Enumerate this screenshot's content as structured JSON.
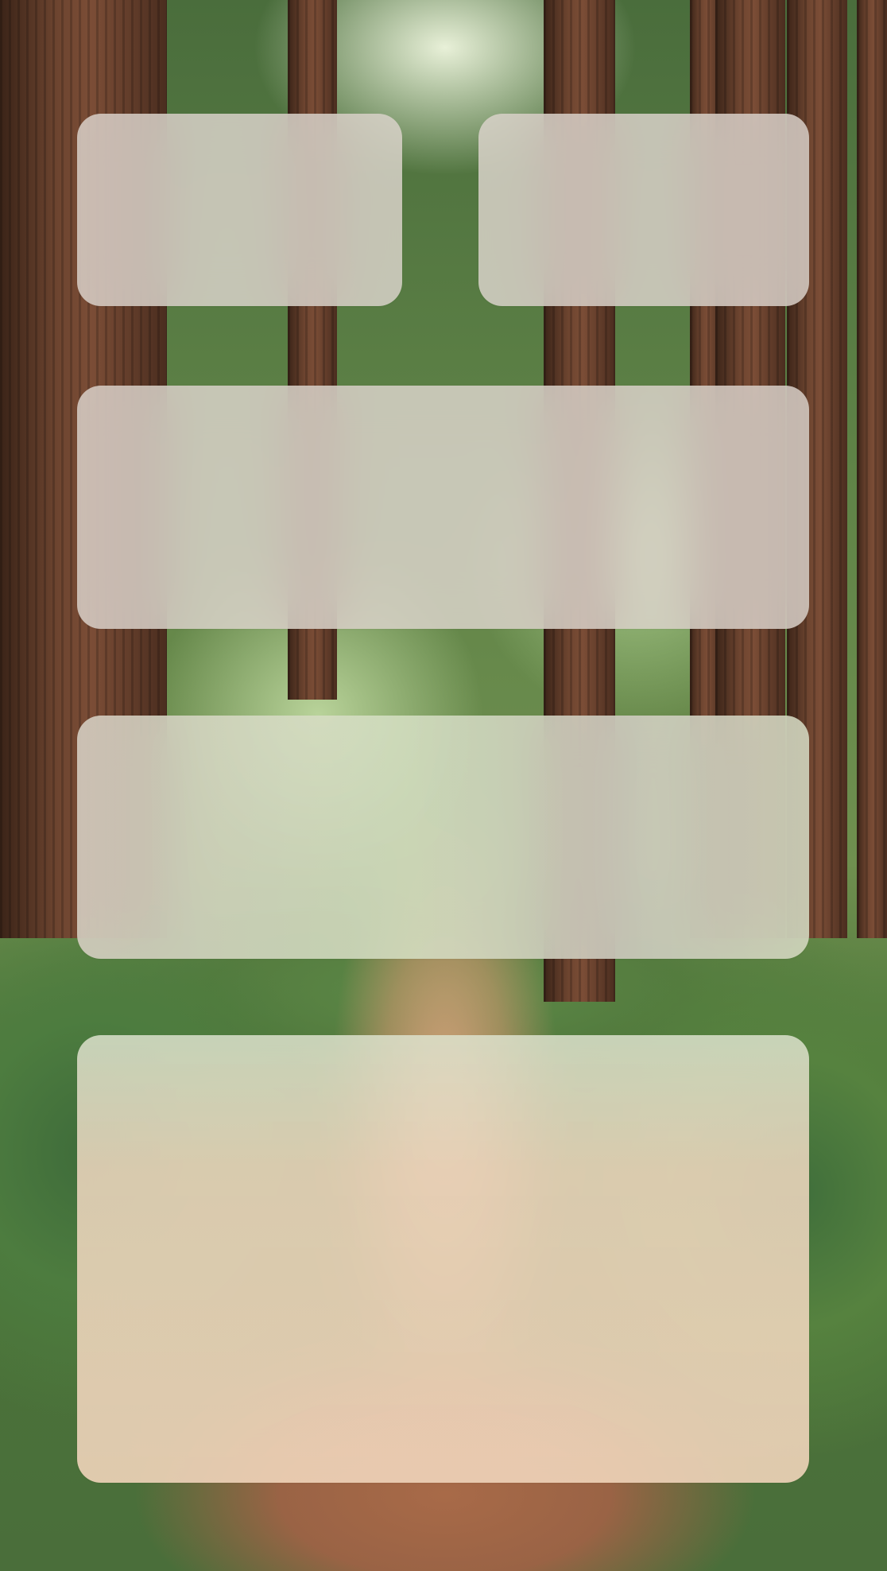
{
  "screen": {
    "wallpaper": "redwood-forest-path",
    "widget_tint": "#ded6ce"
  },
  "widgets": [
    {
      "id": "widget-small-left",
      "size": "small",
      "content": ""
    },
    {
      "id": "widget-small-right",
      "size": "small",
      "content": ""
    },
    {
      "id": "widget-medium-1",
      "size": "medium",
      "content": ""
    },
    {
      "id": "widget-medium-2",
      "size": "medium",
      "content": ""
    },
    {
      "id": "widget-large",
      "size": "large",
      "content": ""
    }
  ]
}
